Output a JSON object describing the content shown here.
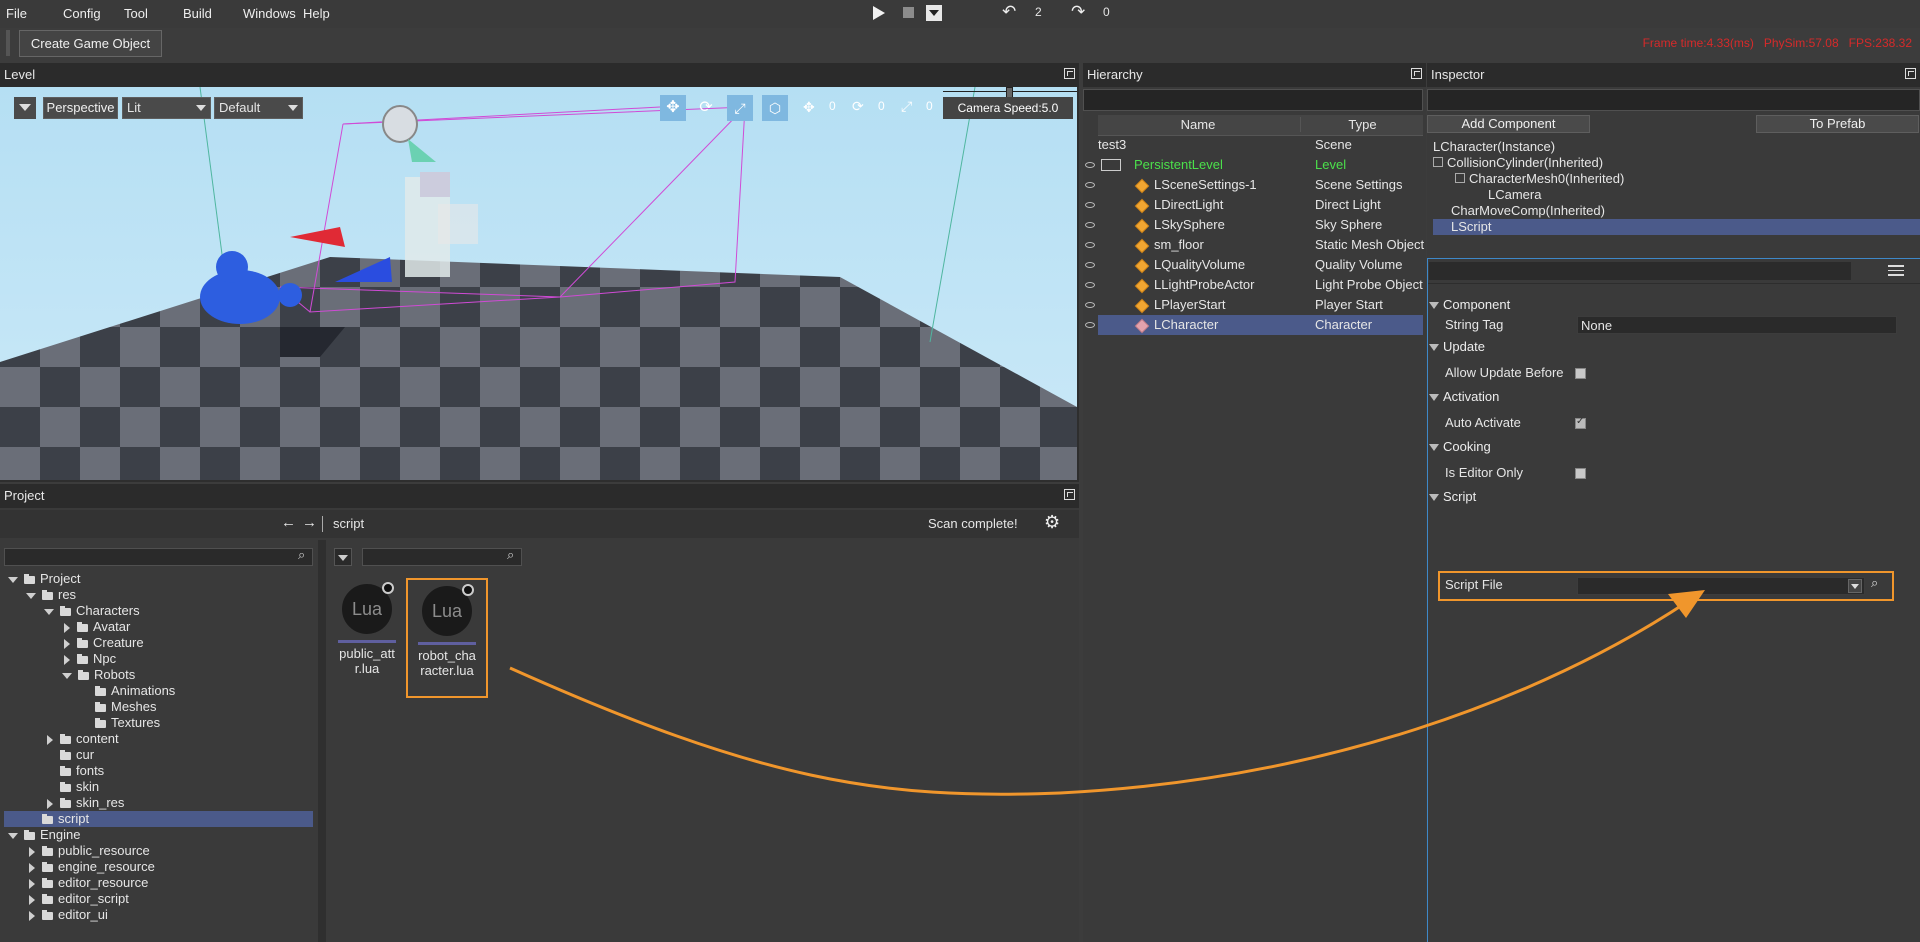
{
  "menu": [
    "File",
    "Config",
    "Tool",
    "Build",
    "Windows",
    "Help"
  ],
  "toolbar": {
    "create_game_object": "Create Game Object",
    "undo_count": "2",
    "redo_count": "0",
    "stats": "Frame time:4.33(ms)   PhySim:57.08   FPS:238.32"
  },
  "level": {
    "title": "Level",
    "view_mode": "Perspective",
    "lighting_mode": "Lit",
    "preset": "Default",
    "camera_speed": "Camera Speed:5.0",
    "move_snap": "0",
    "rotate_snap": "0",
    "scale_snap": "0"
  },
  "hierarchy": {
    "title": "Hierarchy",
    "columns": [
      "Name",
      "Type"
    ],
    "rows": [
      {
        "name": "test3",
        "type": "Scene"
      },
      {
        "name": "PersistentLevel",
        "type": "Level"
      },
      {
        "name": "LSceneSettings-1",
        "type": "Scene Settings"
      },
      {
        "name": "LDirectLight",
        "type": "Direct Light"
      },
      {
        "name": "LSkySphere",
        "type": "Sky Sphere"
      },
      {
        "name": "sm_floor",
        "type": "Static Mesh Object"
      },
      {
        "name": "LQualityVolume",
        "type": "Quality Volume"
      },
      {
        "name": "LLightProbeActor",
        "type": "Light Probe Object"
      },
      {
        "name": "LPlayerStart",
        "type": "Player Start"
      },
      {
        "name": "LCharacter",
        "type": "Character"
      }
    ]
  },
  "inspector": {
    "title": "Inspector",
    "add_component": "Add Component",
    "to_prefab": "To Prefab",
    "components": [
      "LCharacter(Instance)",
      "CollisionCylinder(Inherited)",
      "CharacterMesh0(Inherited)",
      "LCamera",
      "CharMoveComp(Inherited)",
      "LScript"
    ],
    "sections": {
      "component": "Component",
      "string_tag_label": "String Tag",
      "string_tag_value": "None",
      "update": "Update",
      "allow_update_label": "Allow Update Before",
      "activation": "Activation",
      "auto_activate_label": "Auto Activate",
      "cooking": "Cooking",
      "editor_only_label": "Is Editor Only",
      "script": "Script",
      "script_file_label": "Script File"
    }
  },
  "project": {
    "title": "Project",
    "path": "script",
    "status": "Scan complete!",
    "tree": [
      "Project",
      "res",
      "Characters",
      "Avatar",
      "Creature",
      "Npc",
      "Robots",
      "Animations",
      "Meshes",
      "Textures",
      "content",
      "cur",
      "fonts",
      "skin",
      "skin_res",
      "script",
      "Engine",
      "public_resource",
      "engine_resource",
      "editor_resource",
      "editor_script",
      "editor_ui"
    ],
    "files": [
      {
        "name": "public_attr.lua",
        "line1": "public_att",
        "line2": "r.lua",
        "icon": "Lua"
      },
      {
        "name": "robot_character.lua",
        "line1": "robot_cha",
        "line2": "racter.lua",
        "icon": "Lua"
      }
    ]
  },
  "colors": {
    "highlight_orange": "#f0962c",
    "selection_blue": "#4b5a8a",
    "stats_red": "#d62a2a",
    "level_green": "#4be04b"
  }
}
